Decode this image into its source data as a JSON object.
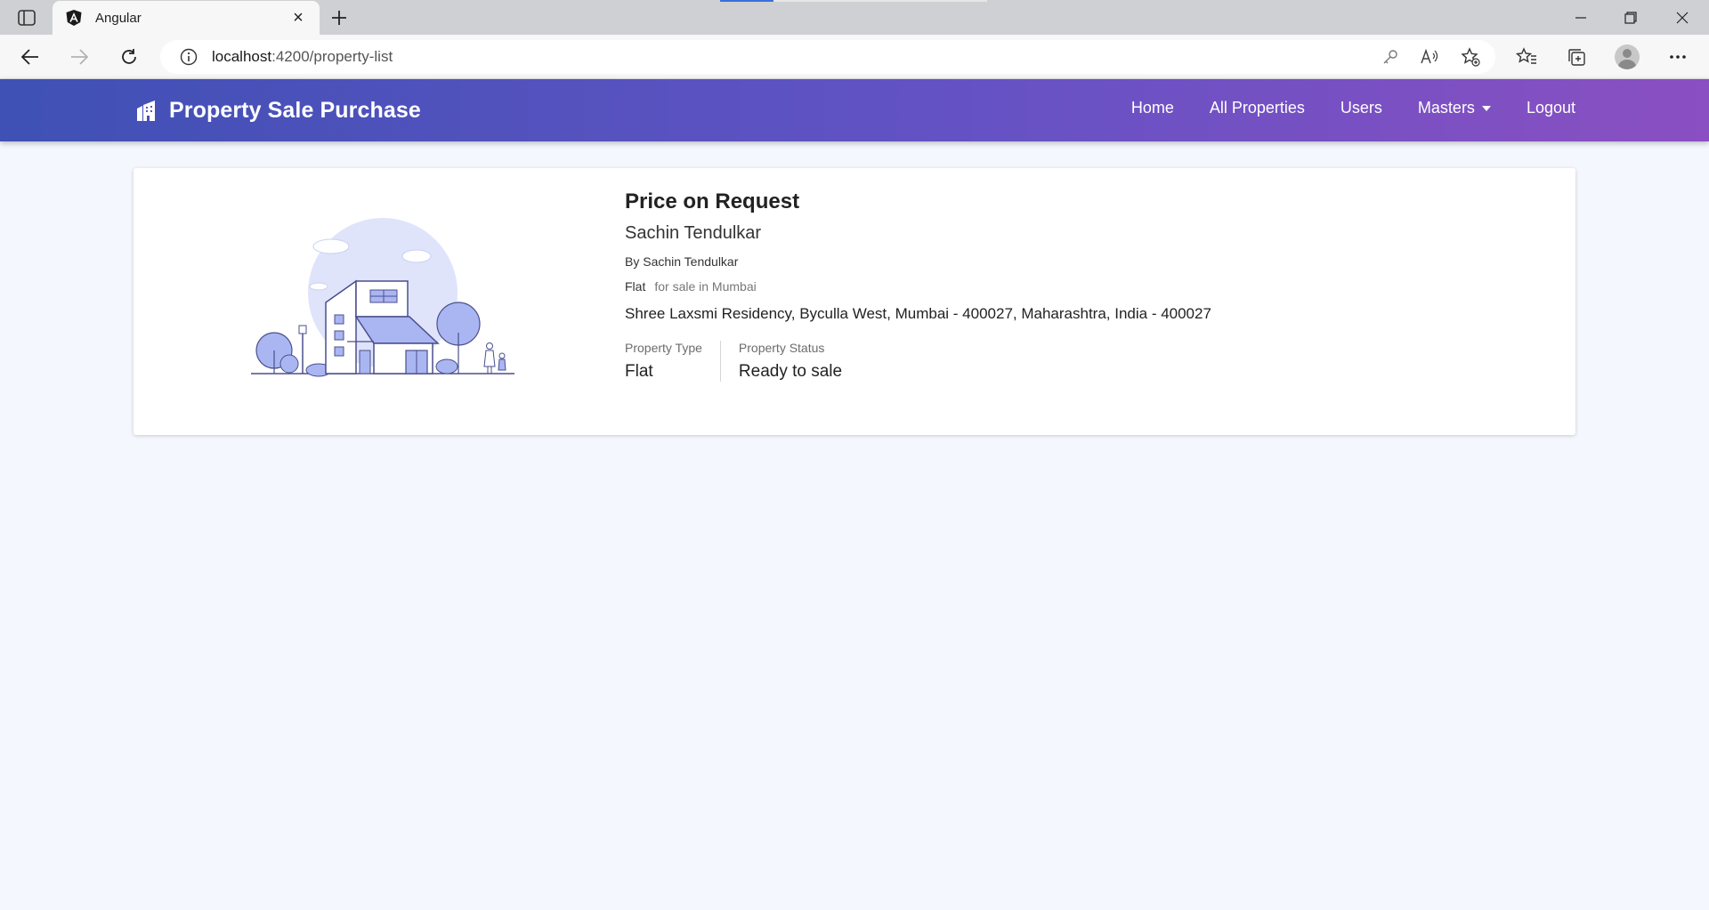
{
  "browser": {
    "tab_title": "Angular",
    "url_host": "localhost",
    "url_path": ":4200/property-list"
  },
  "navbar": {
    "brand": "Property Sale Purchase",
    "links": [
      "Home",
      "All Properties",
      "Users",
      "Masters",
      "Logout"
    ],
    "gradient_start": "#3f51b5",
    "gradient_end": "#8a4fc2"
  },
  "property": {
    "price": "Price on Request",
    "owner": "Sachin Tendulkar",
    "by_line": "By Sachin Tendulkar",
    "type": "Flat",
    "for_sale_text": "for sale in Mumbai",
    "address": "Shree Laxsmi Residency, Byculla West, Mumbai - 400027, Maharashtra, India - 400027",
    "type_label": "Property Type",
    "type_value": "Flat",
    "status_label": "Property Status",
    "status_value": "Ready to sale",
    "image_icon": "house-illustration"
  }
}
